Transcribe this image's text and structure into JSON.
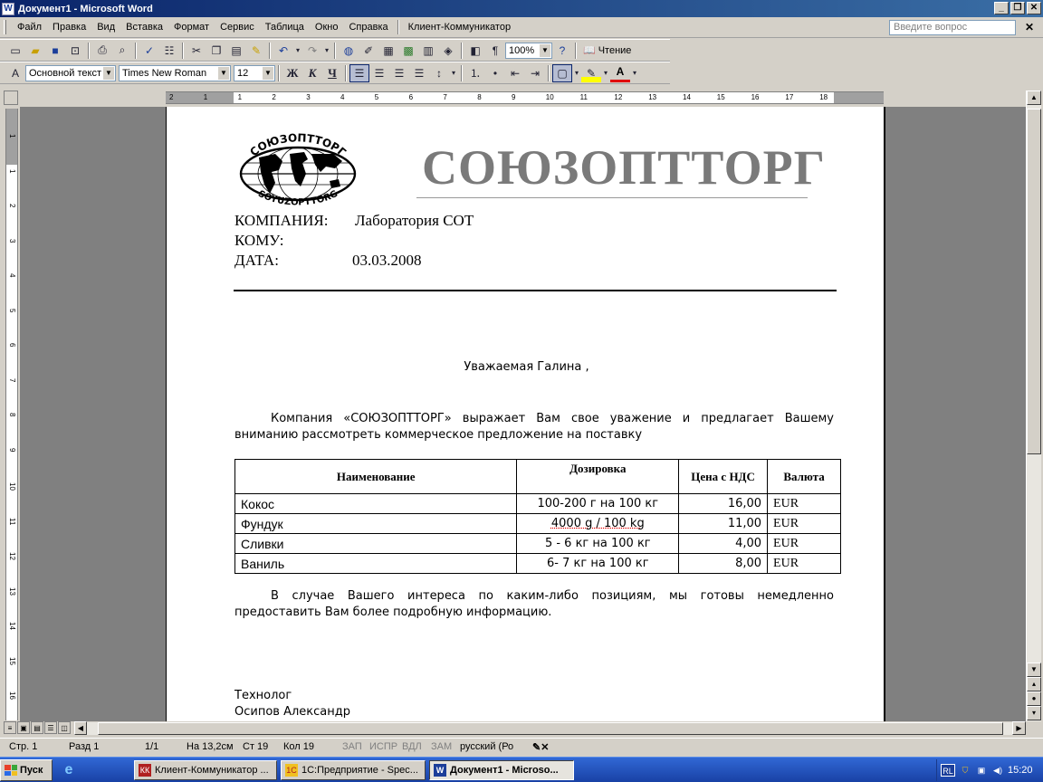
{
  "window": {
    "title": "Документ1 - Microsoft Word",
    "app_icon": "W"
  },
  "menu": {
    "items": [
      "Файл",
      "Правка",
      "Вид",
      "Вставка",
      "Формат",
      "Сервис",
      "Таблица",
      "Окно",
      "Справка",
      "Клиент-Коммуникатор"
    ],
    "ask_placeholder": "Введите вопрос"
  },
  "toolbar": {
    "zoom": "100%",
    "read_label": "Чтение",
    "style": "Основной текст",
    "font": "Times New Roman",
    "font_size": "12",
    "bold_glyph": "Ж",
    "italic_glyph": "К",
    "underline_glyph": "Ч"
  },
  "ruler": {
    "h_numbers": [
      "2",
      "1",
      "1",
      "2",
      "3",
      "4",
      "5",
      "6",
      "7",
      "8",
      "9",
      "10",
      "11",
      "12",
      "13",
      "14",
      "15",
      "16",
      "17",
      "18"
    ],
    "v_numbers": [
      "1",
      "1",
      "2",
      "3",
      "4",
      "5",
      "6",
      "7",
      "8",
      "9",
      "10",
      "11",
      "12",
      "13",
      "14",
      "15",
      "16"
    ]
  },
  "letter": {
    "logo_top": "СОЮЗОПТТОРГ",
    "logo_bottom": "SOYUZOPTTORG",
    "brand": "СОЮЗОПТТОРГ",
    "company_label": "КОМПАНИЯ:",
    "company_value": "Лаборатория СОТ",
    "to_label": "КОМУ:",
    "date_label": "ДАТА:",
    "date_value": "03.03.2008",
    "greeting": "Уважаемая Галина ,",
    "intro": "Компания «СОЮЗОПТТОРГ» выражает Вам свое уважение и предлагает  Вашему вниманию рассмотреть коммерческое предложение на поставку",
    "table": {
      "headers": [
        "Наименование",
        "Дозировка",
        "Цена с НДС",
        "Валюта"
      ],
      "rows": [
        {
          "name": "Кокос",
          "dose": "100-200 г на 100 кг",
          "price": "16,00",
          "currency": "EUR"
        },
        {
          "name": "Фундук",
          "dose": "4000 g / 100 kg",
          "price": "11,00",
          "currency": "EUR"
        },
        {
          "name": "Сливки",
          "dose": "5 - 6 кг на 100 кг",
          "price": "4,00",
          "currency": "EUR"
        },
        {
          "name": "Ваниль",
          "dose": "6- 7 кг на 100 кг",
          "price": "8,00",
          "currency": "EUR"
        }
      ]
    },
    "closing": "В случае Вашего интереса по каким-либо позициям, мы готовы немедленно предоставить Вам более подробную информацию.",
    "signature_title": "Технолог",
    "signature_name": "Осипов Александр"
  },
  "status": {
    "page": "Стр. 1",
    "section": "Разд 1",
    "pages": "1/1",
    "position": "На 13,2см",
    "line": "Ст 19",
    "column": "Кол 19",
    "rec": "ЗАП",
    "trk": "ИСПР",
    "ext": "ВДЛ",
    "ovr": "ЗАМ",
    "language": "русский (Ро"
  },
  "taskbar": {
    "start": "Пуск",
    "tasks": [
      "Клиент-Коммуникатор ...",
      "1С:Предприятие - Spec...",
      "Документ1 - Microso..."
    ],
    "lang": "RL",
    "clock": "15:20"
  }
}
